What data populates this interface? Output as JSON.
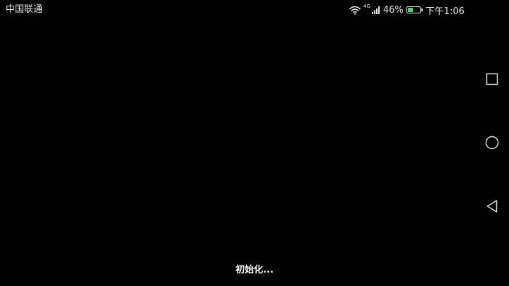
{
  "status_bar": {
    "carrier": "中国联通",
    "network_type": "4G",
    "battery_percent": "46%",
    "battery_level": 0.46,
    "battery_color": "#4cd964",
    "time": "下午1:06",
    "icons": [
      "wifi-icon",
      "signal-icon",
      "battery-icon"
    ]
  },
  "nav_bar": {
    "buttons": [
      "recents-button",
      "home-button",
      "back-button"
    ]
  },
  "main": {
    "loading_text": "初始化..."
  }
}
